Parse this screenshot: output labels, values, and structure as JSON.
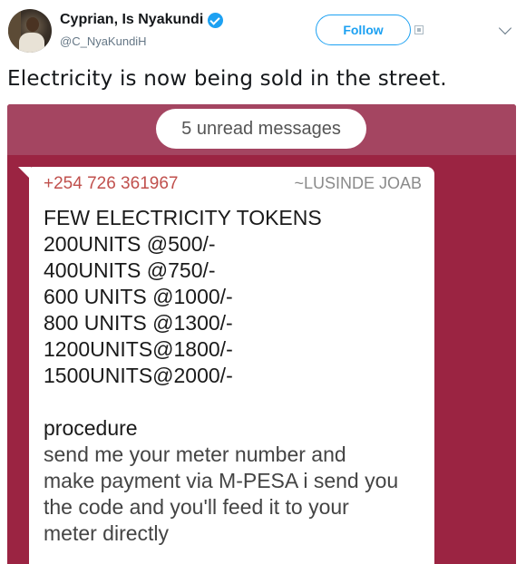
{
  "tweet": {
    "display_name": "Cyprian, Is Nyakundi",
    "handle": "@C_NyaKundiH",
    "follow_label": "Follow",
    "text": "Electricity is now being sold in the street."
  },
  "media": {
    "unread_label": "5 unread messages",
    "message": {
      "sender_phone": "+254 726 361967",
      "sender_name": "~LUSINDE JOAB",
      "lines": [
        "FEW ELECTRICITY TOKENS",
        "200UNITS @500/-",
        "400UNITS @750/-",
        "600 UNITS @1000/-",
        "800 UNITS @1300/-",
        "1200UNITS@1800/-",
        "1500UNITS@2000/-"
      ],
      "procedure_title": "procedure",
      "procedure_lines": [
        "send me your meter number and",
        "make payment via M-PESA i send you",
        "the code and you'll feed it to your",
        "meter directly"
      ]
    }
  },
  "colors": {
    "accent": "#1da1f2",
    "chat_background": "#9b2442",
    "phone_text": "#c0504d"
  },
  "icons": [
    "verified-badge-icon",
    "caret-down-icon"
  ]
}
